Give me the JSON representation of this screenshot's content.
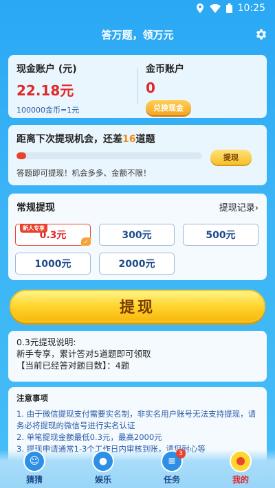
{
  "status": {
    "time": "10:25"
  },
  "header": {
    "title": "答万题，领万元"
  },
  "account": {
    "cash_label": "现金账户 (元)",
    "cash_value": "22.18元",
    "rate": "100000金币=1元",
    "coin_label": "金币账户",
    "coin_value": "0",
    "exchange_label": "兑换现金"
  },
  "progress": {
    "title_prefix": "距离下次提现机会，还差",
    "remaining": "16",
    "title_suffix": "道题",
    "fill_fraction": 0.05,
    "hint": "答题即可提现！机会多多、金额不限！",
    "withdraw_label": "提现"
  },
  "withdraw": {
    "title": "常规提现",
    "records_label": "提现记录",
    "new_tag": "新人专享",
    "options": [
      "0.3元",
      "300元",
      "500元",
      "1000元",
      "2000元"
    ]
  },
  "big_button": {
    "label": "提现"
  },
  "explain": {
    "line1": "0.3元提现说明:",
    "line2": "新手专享，累计答对5道题即可领取",
    "line3": "【当前已经答对题目数】：4题"
  },
  "notes": {
    "title": "注意事项",
    "item1": "1. 由于微信提现支付需要实名制，非实名用户账号无法支持提现，请务必将提现的微信号进行实名认证",
    "item2": "2. 单笔提现金额最低0.3元，最高2000元",
    "item3": "3. 提现申请通常1-3个工作日内审核到账，请您耐心等"
  },
  "nav": {
    "items": [
      {
        "label": "猜猜"
      },
      {
        "label": "娱乐"
      },
      {
        "label": "任务",
        "badge": "3"
      },
      {
        "label": "我的"
      }
    ]
  },
  "colors": {
    "accent": "#e0262a",
    "brand": "#2aa8f4",
    "gold": "#ffd52e"
  }
}
